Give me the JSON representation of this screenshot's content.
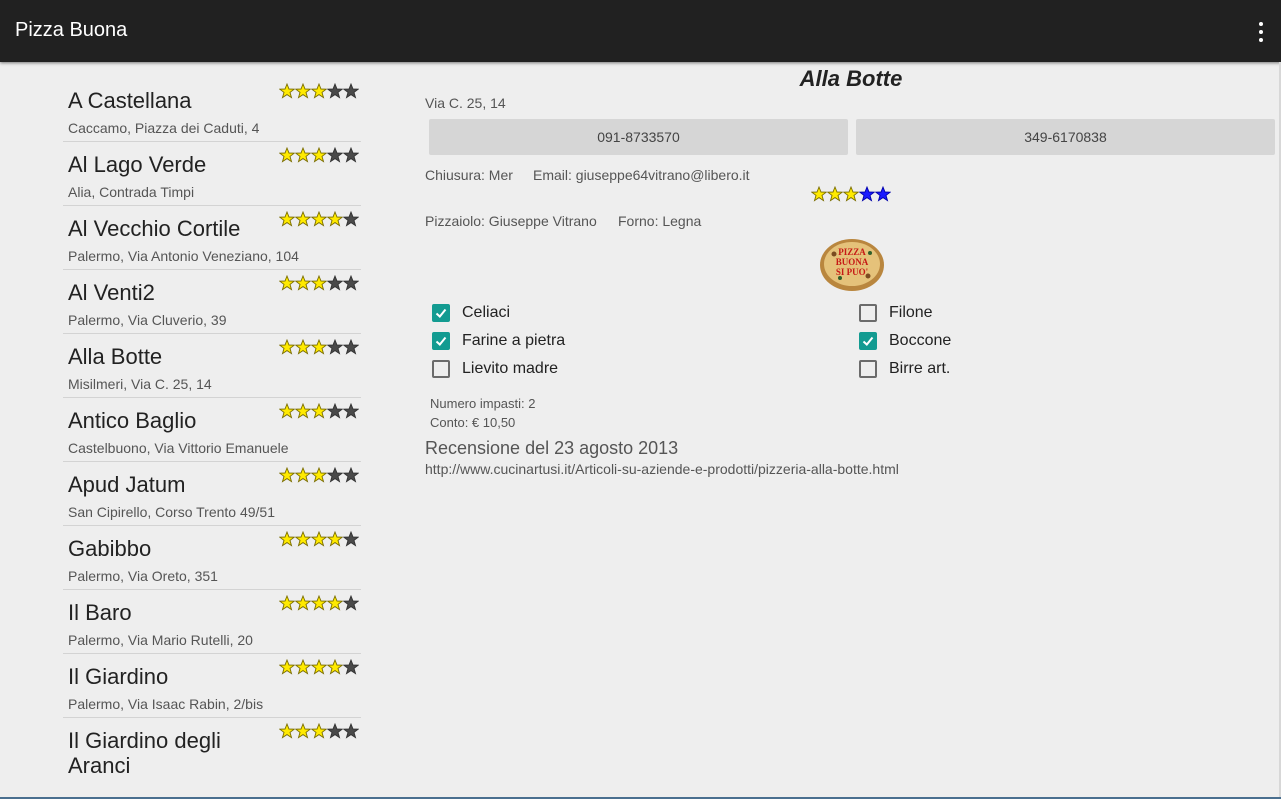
{
  "app": {
    "title": "Pizza Buona",
    "menu_icon": "overflow-menu-icon"
  },
  "colors": {
    "action_bar": "#212121",
    "star_filled": "#ffea00",
    "star_empty": "#4a4a4a",
    "star_blue": "#1a1aff",
    "checkbox_accent": "#139b91"
  },
  "list": [
    {
      "name": "A Castellana",
      "address": "Caccamo, Piazza dei Caduti, 4",
      "rating": 3,
      "max_rating": 5
    },
    {
      "name": "Al Lago Verde",
      "address": "Alia, Contrada Timpi",
      "rating": 3,
      "max_rating": 5
    },
    {
      "name": "Al Vecchio Cortile",
      "address": "Palermo, Via Antonio Veneziano, 104",
      "rating": 4,
      "max_rating": 5
    },
    {
      "name": "Al Venti2",
      "address": "Palermo, Via Cluverio, 39",
      "rating": 3,
      "max_rating": 5
    },
    {
      "name": "Alla Botte",
      "address": "Misilmeri, Via C. 25, 14",
      "rating": 3,
      "max_rating": 5
    },
    {
      "name": "Antico Baglio",
      "address": "Castelbuono, Via Vittorio Emanuele",
      "rating": 3,
      "max_rating": 5
    },
    {
      "name": "Apud Jatum",
      "address": "San Cipirello, Corso Trento 49/51",
      "rating": 3,
      "max_rating": 5
    },
    {
      "name": "Gabibbo",
      "address": "Palermo, Via Oreto, 351",
      "rating": 4,
      "max_rating": 5
    },
    {
      "name": "Il Baro",
      "address": "Palermo, Via Mario Rutelli, 20",
      "rating": 4,
      "max_rating": 5
    },
    {
      "name": "Il Giardino",
      "address": "Palermo, Via Isaac Rabin, 2/bis",
      "rating": 4,
      "max_rating": 5
    },
    {
      "name": "Il Giardino degli Aranci",
      "address": "",
      "rating": 3,
      "max_rating": 5
    }
  ],
  "detail": {
    "title": "Alla Botte",
    "address": "Via C. 25, 14",
    "phone1": "091-8733570",
    "phone2": "349-6170838",
    "closing": "Chiusura: Mer",
    "email": "Email: giuseppe64vitrano@libero.it",
    "rating": 3,
    "max_rating": 5,
    "pizzaiolo": "Pizzaiolo: Giuseppe Vitrano",
    "forno": "Forno: Legna",
    "logo_text": [
      "PIZZA",
      "BUONA",
      "SI PUO'"
    ],
    "features_left": [
      {
        "label": "Celiaci",
        "checked": true
      },
      {
        "label": "Farine a pietra",
        "checked": true
      },
      {
        "label": "Lievito madre",
        "checked": false
      }
    ],
    "features_right": [
      {
        "label": "Filone",
        "checked": false
      },
      {
        "label": "Boccone",
        "checked": true
      },
      {
        "label": "Birre art.",
        "checked": false
      }
    ],
    "impasti": "Numero impasti: 2",
    "conto": "Conto: € 10,50",
    "review_title": "Recensione del 23 agosto 2013",
    "review_link": "http://www.cucinartusi.it/Articoli-su-aziende-e-prodotti/pizzeria-alla-botte.html"
  }
}
